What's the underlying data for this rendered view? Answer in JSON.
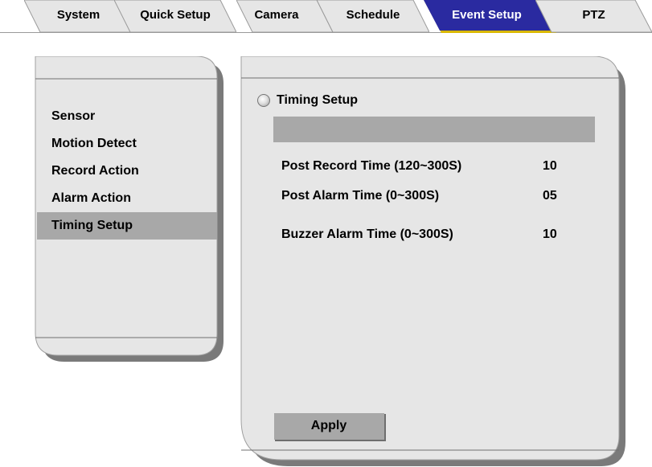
{
  "tabs": [
    {
      "label": "System"
    },
    {
      "label": "Quick Setup"
    },
    {
      "label": "Camera"
    },
    {
      "label": "Schedule"
    },
    {
      "label": "Event Setup",
      "active": true
    },
    {
      "label": "PTZ"
    }
  ],
  "sidebar": {
    "items": [
      {
        "label": "Sensor"
      },
      {
        "label": "Motion Detect"
      },
      {
        "label": "Record Action"
      },
      {
        "label": "Alarm Action"
      },
      {
        "label": "Timing Setup",
        "selected": true
      }
    ]
  },
  "main": {
    "section_title": "Timing Setup",
    "settings": [
      {
        "label": "Post Record Time (120~300S)",
        "value": "10"
      },
      {
        "label": "Post Alarm Time (0~300S)",
        "value": "05"
      },
      {
        "label": "Buzzer Alarm Time (0~300S)",
        "value": "10"
      }
    ],
    "apply_label": "Apply"
  },
  "colors": {
    "active_tab": "#2a2aa0",
    "active_tab_edge": "#e0c000",
    "panel_fill": "#e6e6e6",
    "panel_shadow": "#7a7a7a",
    "highlight": "#a8a8a8"
  }
}
